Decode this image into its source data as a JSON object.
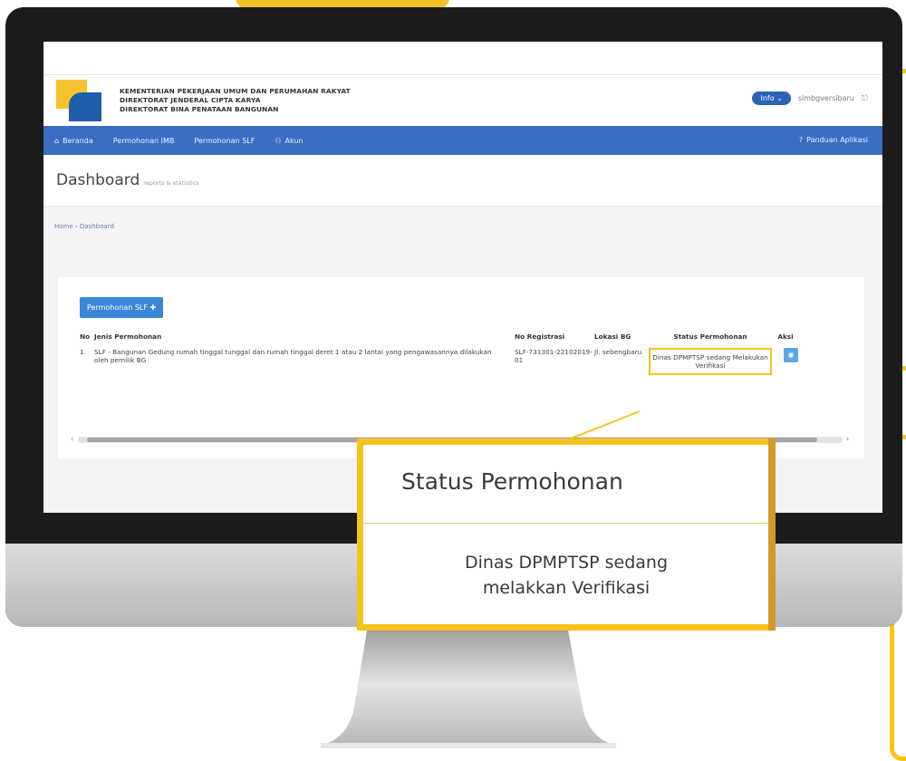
{
  "app": {
    "org_line1": "KEMENTERIAN PEKERJAAN UMUM DAN PERUMAHAN RAKYAT",
    "org_line2": "DIREKTORAT JENDERAL CIPTA KARYA",
    "org_line3": "DIREKTORAT BINA PENATAAN BANGUNAN",
    "info_button": "Info",
    "user_name": "simbgversibaru"
  },
  "nav": {
    "items": [
      {
        "label": "Beranda",
        "icon": "home-icon"
      },
      {
        "label": "Permohonan IMB",
        "icon": ""
      },
      {
        "label": "Permohonan SLF",
        "icon": ""
      },
      {
        "label": "Akun",
        "icon": "user-icon"
      }
    ],
    "guide": "Panduan Aplikasi"
  },
  "page": {
    "title": "Dashboard",
    "subtitle": "reports & statistics",
    "breadcrumb": "Home › Dashboard"
  },
  "card": {
    "add_button": "Permohonan SLF"
  },
  "table": {
    "headers": {
      "no": "No",
      "jenis": "Jenis Permohonan",
      "reg": "No Registrasi",
      "lokasi": "Lokasi BG",
      "status": "Status Permohonan",
      "aksi": "Aksi"
    },
    "rows": [
      {
        "no": "1",
        "jenis": "SLF - Bangunan Gedung rumah tinggal tunggal dan rumah tinggal deret 1 atau 2 lantai yang pengawasannya dilakukan oleh pemilik BG",
        "reg": "SLF-731301-22102019-01",
        "lokasi": "Jl. sebengbaru",
        "status": "Dinas DPMPTSP sedang Melakukan Verifikasi"
      }
    ]
  },
  "callout": {
    "title": "Status Permohonan",
    "line1": "Dinas DPMPTSP sedang",
    "line2": "melakkan Verifikasi"
  },
  "colors": {
    "accent_yellow": "#f6c21c",
    "nav_blue": "#3a6ec3"
  }
}
